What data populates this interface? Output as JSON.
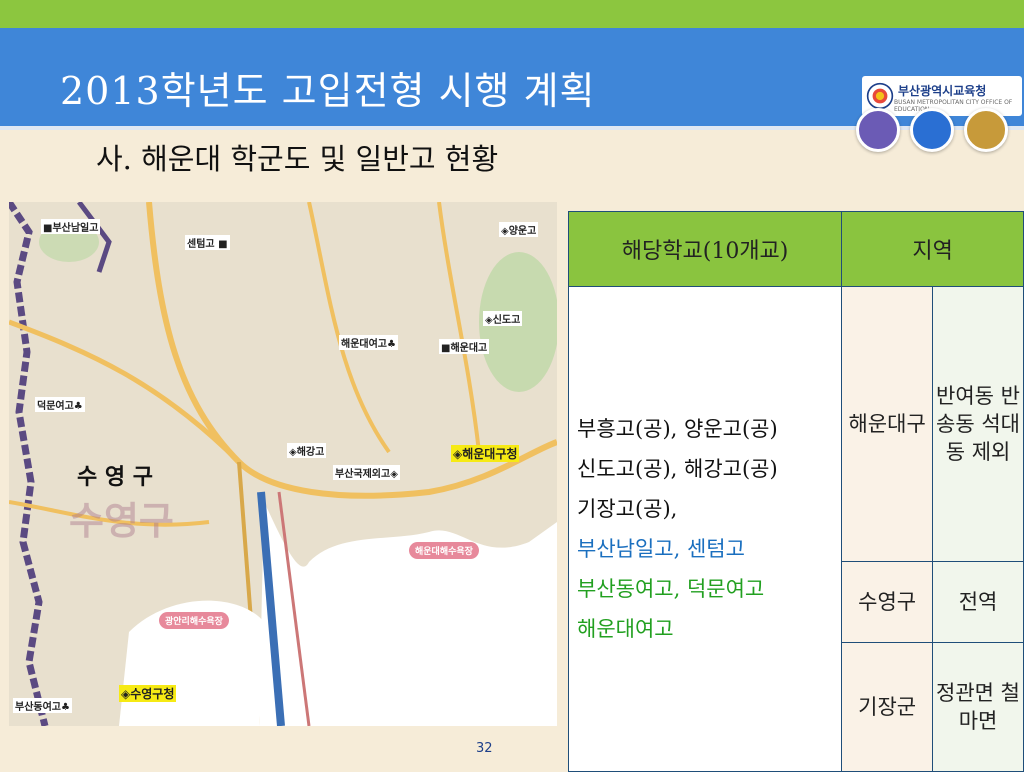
{
  "slide": {
    "title": "2013학년도 고입전형 시행 계획",
    "subtitle": "사. 해운대 학군도 및 일반고 현황",
    "page_number": "32"
  },
  "logo": {
    "name": "부산광역시교육청",
    "sub": "BUSAN METROPOLITAN CITY OFFICE OF EDUCATION"
  },
  "decor_dots": [
    {
      "name": "purple-dot",
      "color": "#6b5bb5"
    },
    {
      "name": "blue-dot",
      "color": "#2a6fd3"
    },
    {
      "name": "gold-dot",
      "color": "#c79a3a"
    }
  ],
  "map": {
    "district_label": "수 영 구",
    "district_watermark": "수영구",
    "labels": {
      "busan_namil": "■부산남일고",
      "centum": "센텀고 ■",
      "yangun": "◈양운고",
      "sindo": "◈신도고",
      "haeundae_yeogo": "해운대여고♣",
      "haeundae_go": "■해운대고",
      "deokmun": "덕문여고♣",
      "haegang": "◈해강고",
      "haeundae_office": "◈해운대구청",
      "gukje": "부산국제외고◈",
      "beach_haeundae": "해운대해수욕장",
      "beach_gwangan": "광안리해수욕장",
      "busan_dongyeo": "부산동여고♣",
      "suyeong_office": "◈수영구청"
    }
  },
  "table": {
    "header_school": "해당학교(10개교)",
    "header_area": "지역",
    "schools": [
      {
        "text": "부흥고(공), 양운고(공)",
        "color": "dark"
      },
      {
        "text": "신도고(공), 해강고(공)",
        "color": "dark"
      },
      {
        "text": "기장고(공),",
        "color": "dark"
      },
      {
        "text": "부산남일고, 센텀고",
        "color": "blue"
      },
      {
        "text": "부산동여고, 덕문여고",
        "color": "green"
      },
      {
        "text": "해운대여고",
        "color": "green"
      }
    ],
    "rows": [
      {
        "gu": "해운대구",
        "area": "반여동 반송동 석대동 제외"
      },
      {
        "gu": "수영구",
        "area": "전역"
      },
      {
        "gu": "기장군",
        "area": "정관면 철마면"
      }
    ]
  }
}
